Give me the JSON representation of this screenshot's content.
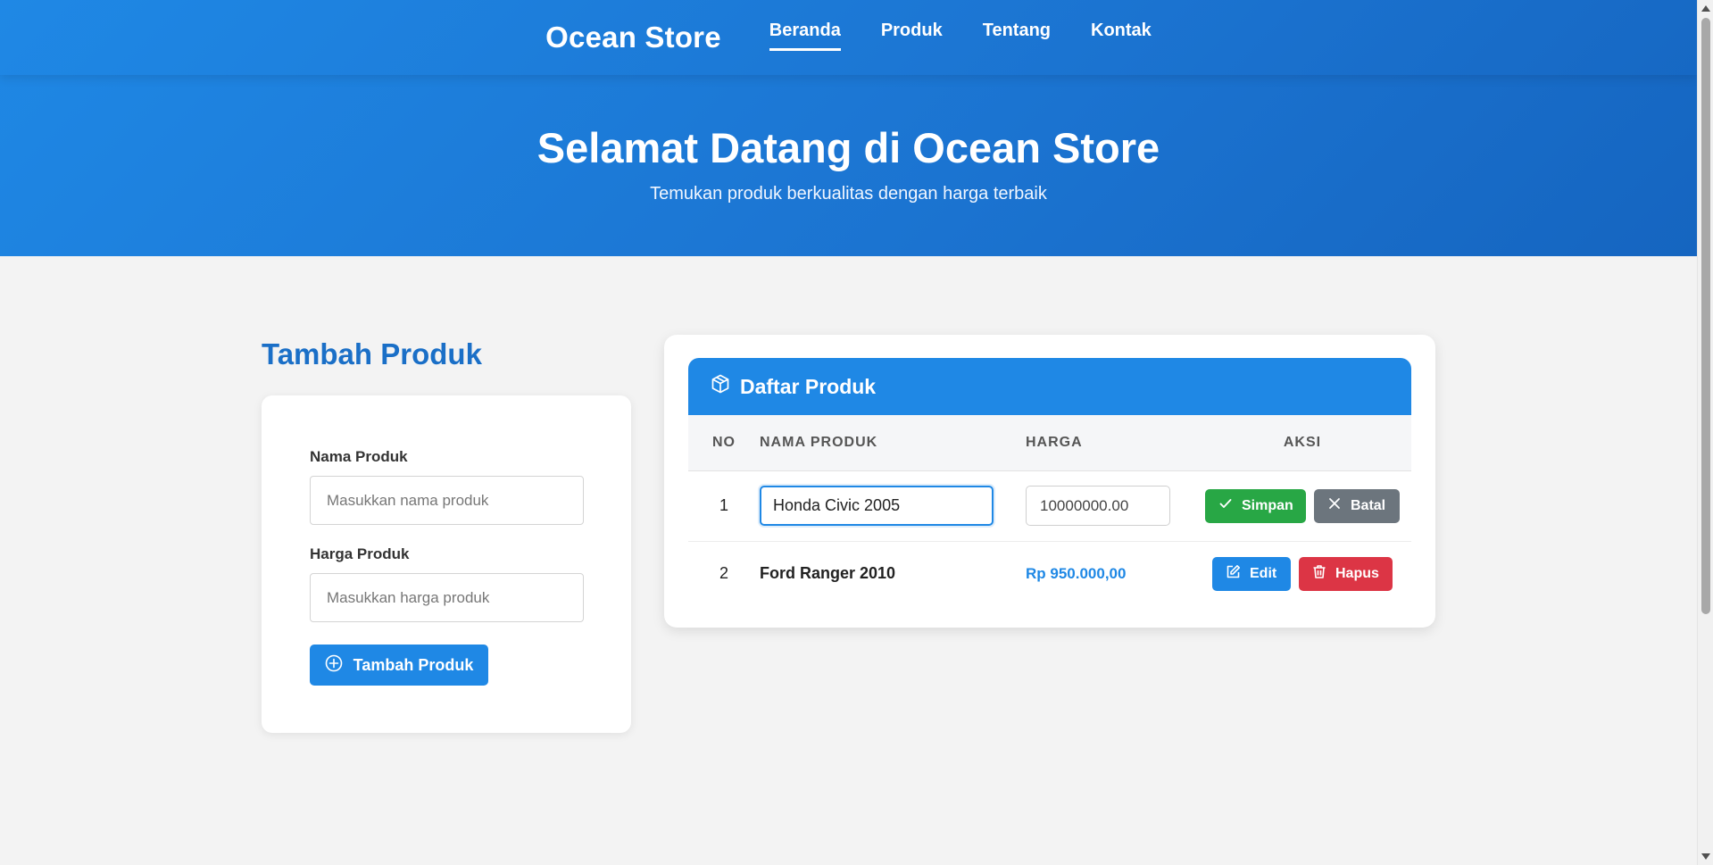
{
  "header": {
    "brand": "Ocean Store",
    "nav": [
      {
        "label": "Beranda",
        "active": true
      },
      {
        "label": "Produk",
        "active": false
      },
      {
        "label": "Tentang",
        "active": false
      },
      {
        "label": "Kontak",
        "active": false
      }
    ]
  },
  "hero": {
    "title": "Selamat Datang di Ocean Store",
    "subtitle": "Temukan produk berkualitas dengan harga terbaik"
  },
  "form": {
    "title": "Tambah Produk",
    "name_label": "Nama Produk",
    "name_placeholder": "Masukkan nama produk",
    "price_label": "Harga Produk",
    "price_placeholder": "Masukkan harga produk",
    "submit_label": "Tambah Produk",
    "submit_icon": "plus-circle-icon"
  },
  "product_list": {
    "title": "Daftar Produk",
    "title_icon": "box-icon",
    "columns": [
      "No",
      "Nama Produk",
      "Harga",
      "Aksi"
    ],
    "rows": [
      {
        "no": "1",
        "editing": true,
        "name_value": "Honda Civic 2005",
        "price_value": "10000000.00",
        "actions": [
          "Simpan",
          "Batal"
        ]
      },
      {
        "no": "2",
        "editing": false,
        "name": "Ford Ranger 2010",
        "price": "Rp 950.000,00",
        "actions": [
          "Edit",
          "Hapus"
        ]
      }
    ]
  },
  "colors": {
    "primary": "#1f88e5",
    "success": "#28a745",
    "secondary": "#6c757d",
    "danger": "#dc3545",
    "heading_blue": "#1a6fc7"
  }
}
